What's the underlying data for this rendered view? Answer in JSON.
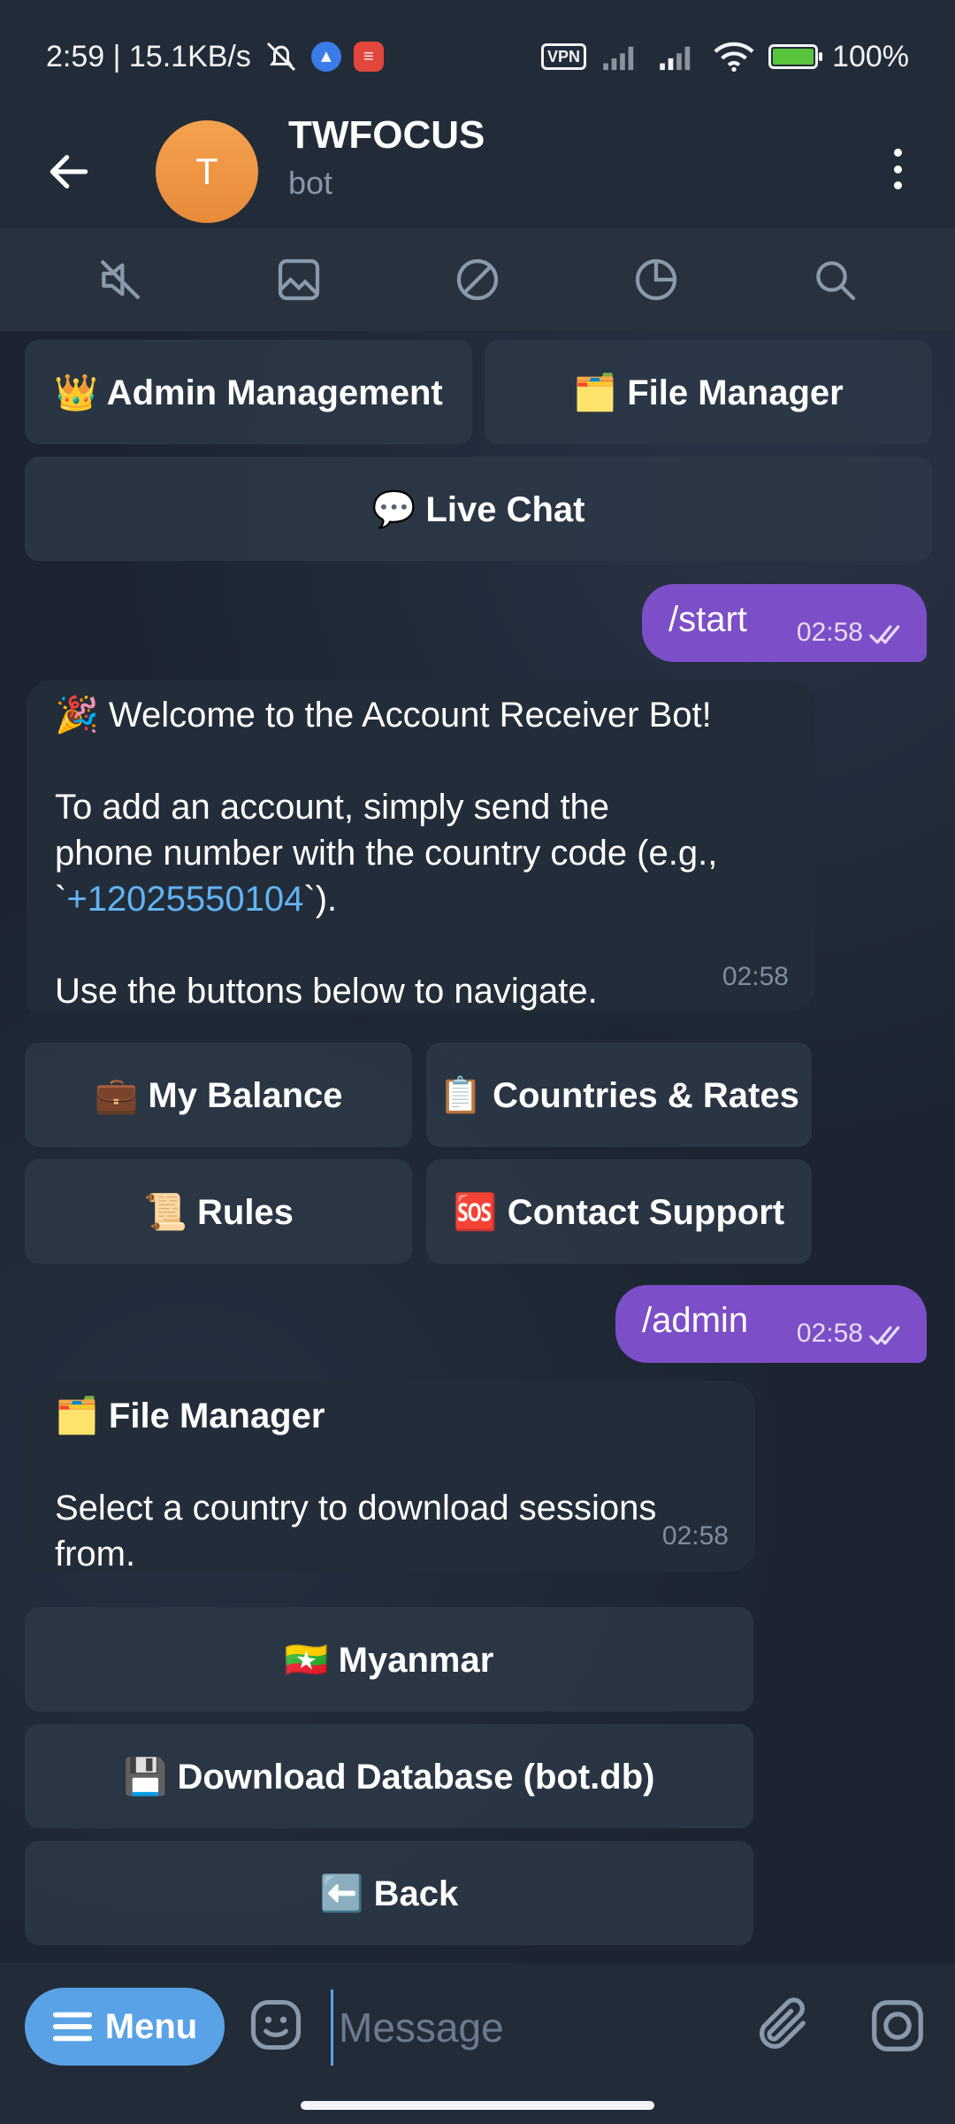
{
  "status_bar": {
    "time_speed": "2:59 | 15.1KB/s",
    "vpn": "VPN",
    "battery": "100%",
    "battery_level": 1.0,
    "icons": [
      "mute-icon",
      "app-icon",
      "app-icon",
      "vpn-icon",
      "signal-icon",
      "signal-icon",
      "wifi-icon",
      "battery-icon"
    ]
  },
  "header": {
    "avatar_letter": "T",
    "title": "TWFOCUS",
    "subtitle": "bot"
  },
  "toolbar": {
    "icons": [
      "mute-icon",
      "gallery-icon",
      "block-icon",
      "stats-icon",
      "search-icon"
    ]
  },
  "chat": {
    "top_keyboard": {
      "admin_management": "👑 Admin Management",
      "file_manager": "🗂️ File Manager",
      "live_chat": "💬 Live Chat"
    },
    "start_message": {
      "text": "/start",
      "time": "02:58"
    },
    "welcome_message": {
      "line1": "🎉 Welcome to the Account Receiver Bot!",
      "line2a": "To add an account, simply send the",
      "line2b": "phone number with the country code (e.g.,",
      "phone_tick_open": "`",
      "phone": "+12025550104",
      "phone_tail": "`).",
      "line3": "Use the buttons below to navigate.",
      "time": "02:58"
    },
    "welcome_keyboard": {
      "my_balance": "💼 My Balance",
      "countries_rates": "📋 Countries & Rates",
      "rules": "📜 Rules",
      "contact_support": "🆘 Contact Support"
    },
    "admin_message": {
      "text": "/admin",
      "time": "02:58"
    },
    "file_manager_message": {
      "title": "🗂️ File Manager",
      "body_a": "Select a country to download sessions",
      "body_b": "from.",
      "time": "02:58"
    },
    "file_manager_keyboard": {
      "myanmar": "🇲🇲 Myanmar",
      "download_db": "💾 Download Database (bot.db)",
      "back": "⬅️ Back"
    }
  },
  "input": {
    "menu_label": "Menu",
    "placeholder": "Message"
  },
  "colors": {
    "header_bg": "#222c39",
    "outgoing_bubble": "#7c4ec7",
    "incoming_bubble": "#232d3a",
    "accent": "#5aa2e6",
    "link": "#62b3f2"
  }
}
